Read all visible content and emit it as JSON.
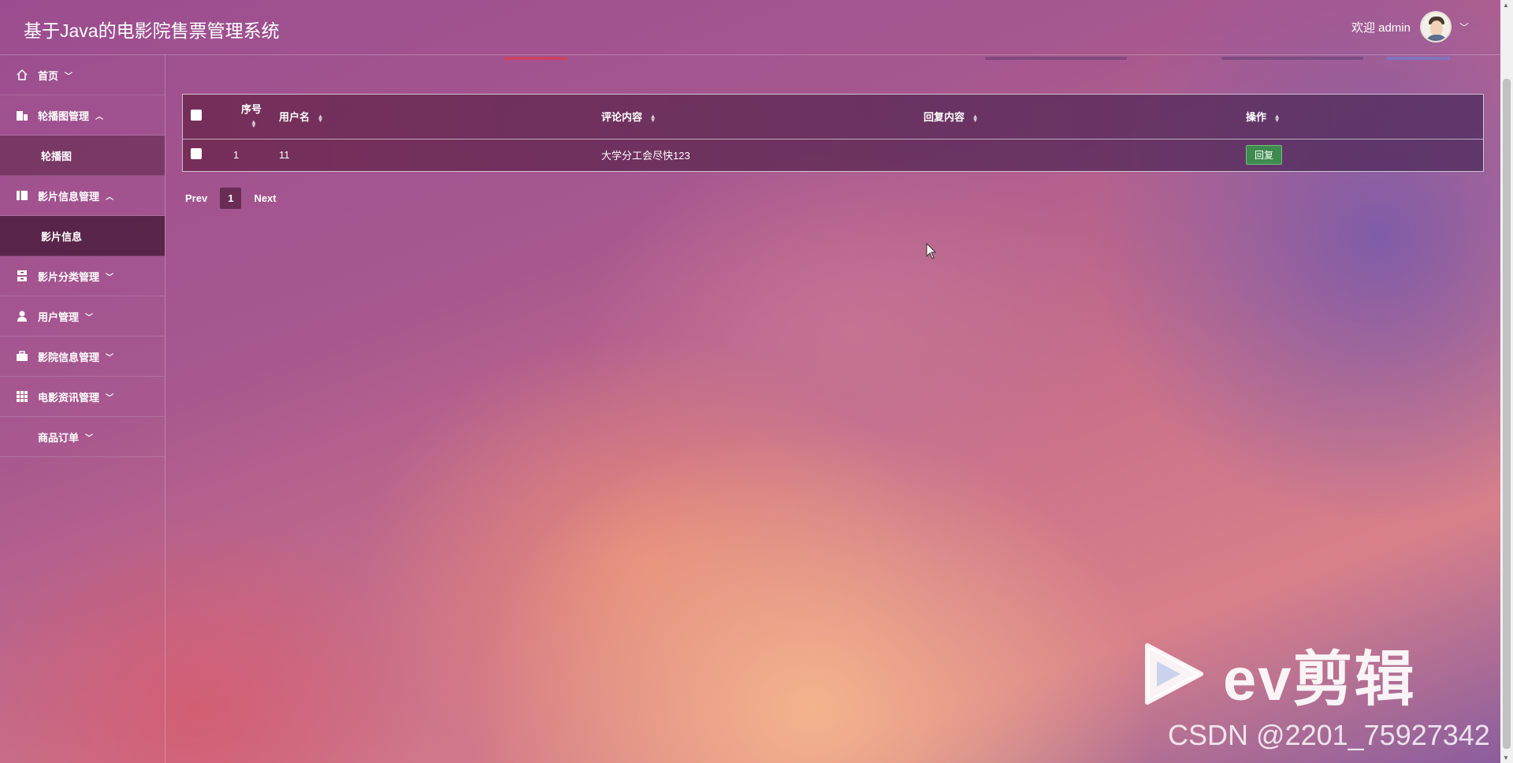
{
  "header": {
    "title": "基于Java的电影院售票管理系统",
    "welcome": "欢迎 admin"
  },
  "sidebar": {
    "items": [
      {
        "label": "首页",
        "icon": "home-icon",
        "arrow": "﹀"
      },
      {
        "label": "轮播图管理",
        "icon": "building-icon",
        "arrow": "︿",
        "sub": "轮播图"
      },
      {
        "label": "影片信息管理",
        "icon": "book-icon",
        "arrow": "︿",
        "sub": "影片信息"
      },
      {
        "label": "影片分类管理",
        "icon": "archive-icon",
        "arrow": "﹀"
      },
      {
        "label": "用户管理",
        "icon": "user-icon",
        "arrow": "﹀"
      },
      {
        "label": "影院信息管理",
        "icon": "briefcase-icon",
        "arrow": "﹀"
      },
      {
        "label": "电影资讯管理",
        "icon": "grid-icon",
        "arrow": "﹀"
      },
      {
        "label": "商品订单",
        "icon": "",
        "arrow": "﹀"
      }
    ]
  },
  "table": {
    "headers": [
      "序号",
      "用户名",
      "评论内容",
      "回复内容",
      "操作"
    ],
    "rows": [
      {
        "index": "1",
        "username": "11",
        "comment": "大学分工会尽快123",
        "reply": "",
        "action": "回复"
      }
    ]
  },
  "pagination": {
    "prev": "Prev",
    "current": "1",
    "next": "Next"
  },
  "watermark": {
    "logo_text": "ev剪辑",
    "csdn": "CSDN @2201_75927342"
  }
}
